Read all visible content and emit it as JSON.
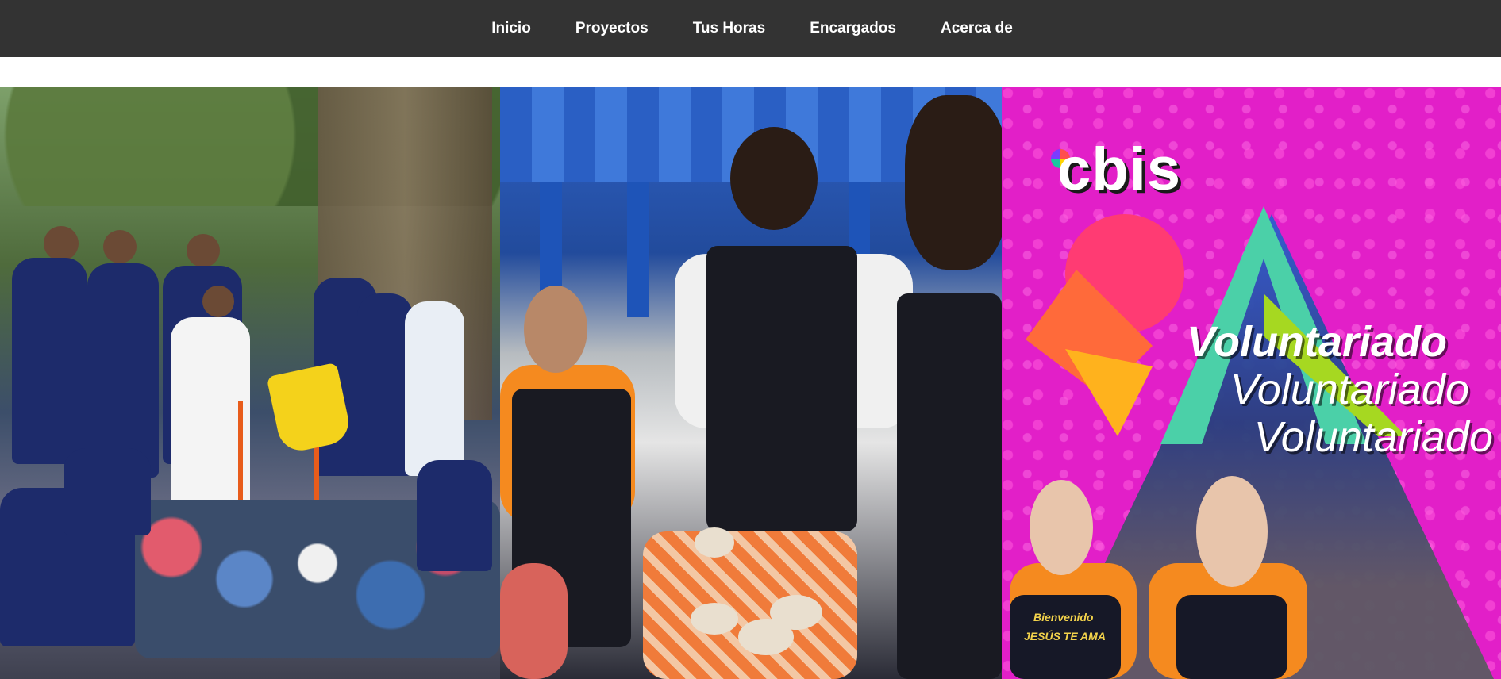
{
  "nav": {
    "items": [
      "Inicio",
      "Proyectos",
      "Tus Horas",
      "Encargados",
      "Acerca de"
    ]
  },
  "gallery": {
    "panel_3": {
      "logo_text": "cbis",
      "title_lines": [
        "Voluntariado",
        "Voluntariado",
        "Voluntariado"
      ],
      "apron_text_1": "Bienvenido",
      "apron_text_2": "JESÚS TE AMA"
    }
  },
  "colors": {
    "nav_bg": "#333333",
    "nav_text": "#ffffff",
    "brand_magenta": "#e21fc8",
    "accent_orange": "#f58a1f"
  }
}
